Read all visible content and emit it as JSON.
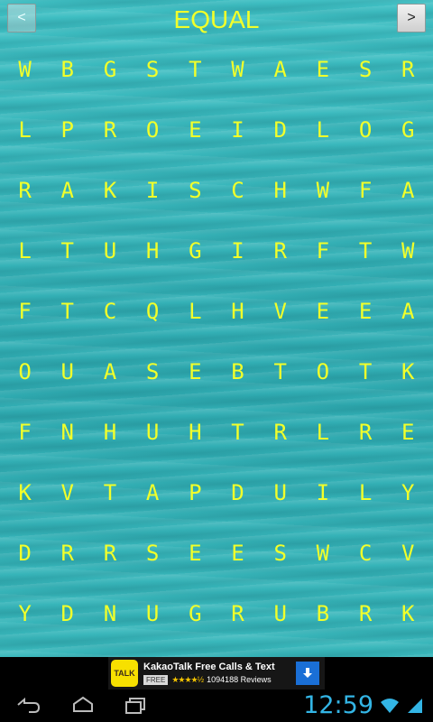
{
  "header": {
    "prev_label": "<",
    "title": "EQUAL",
    "next_label": ">"
  },
  "grid": [
    [
      "W",
      "B",
      "G",
      "S",
      "T",
      "W",
      "A",
      "E",
      "S",
      "R"
    ],
    [
      "L",
      "P",
      "R",
      "O",
      "E",
      "I",
      "D",
      "L",
      "O",
      "G"
    ],
    [
      "R",
      "A",
      "K",
      "I",
      "S",
      "C",
      "H",
      "W",
      "F",
      "A"
    ],
    [
      "L",
      "T",
      "U",
      "H",
      "G",
      "I",
      "R",
      "F",
      "T",
      "W"
    ],
    [
      "F",
      "T",
      "C",
      "Q",
      "L",
      "H",
      "V",
      "E",
      "E",
      "A"
    ],
    [
      "O",
      "U",
      "A",
      "S",
      "E",
      "B",
      "T",
      "O",
      "T",
      "K"
    ],
    [
      "F",
      "N",
      "H",
      "U",
      "H",
      "T",
      "R",
      "L",
      "R",
      "E"
    ],
    [
      "K",
      "V",
      "T",
      "A",
      "P",
      "D",
      "U",
      "I",
      "L",
      "Y"
    ],
    [
      "D",
      "R",
      "R",
      "S",
      "E",
      "E",
      "S",
      "W",
      "C",
      "V"
    ],
    [
      "Y",
      "D",
      "N",
      "U",
      "G",
      "R",
      "U",
      "B",
      "R",
      "K"
    ]
  ],
  "ad": {
    "logo_text": "TALK",
    "title": "KakaoTalk Free Calls & Text",
    "free_badge": "FREE",
    "stars": "★★★★½",
    "reviews": "1094188 Reviews",
    "download_icon": "download-arrow-icon"
  },
  "system_bar": {
    "time": "12:59",
    "icons": [
      "back-icon",
      "home-icon",
      "recent-apps-icon",
      "wifi-icon",
      "signal-icon"
    ]
  }
}
